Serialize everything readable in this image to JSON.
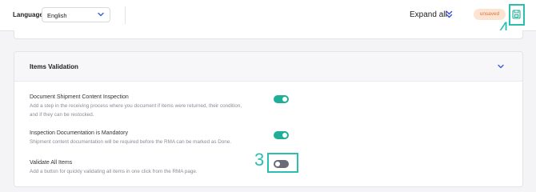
{
  "topbar": {
    "language_label": "Language",
    "language_value": "English",
    "expand_all_label": "Expand all",
    "status_badge": "unsaved",
    "callout_top": "4"
  },
  "section": {
    "title": "Items Validation",
    "settings": [
      {
        "title": "Document Shipment Content Inspection",
        "description_line1": "Add a step in the receiving process where you document if items were returned, their condition,",
        "description_line2": "and if they can be restocked.",
        "enabled": true
      },
      {
        "title": "Inspection Documentation is Mandatory",
        "description_line1": "Shipment content documentation will be required before the RMA can be marked as Done.",
        "enabled": true
      },
      {
        "title": "Validate All Items",
        "description_line1": "Add a button for quickly validating all items in one click from the RMA page.",
        "enabled": false
      }
    ],
    "callout_toggle": "3"
  },
  "colors": {
    "accent": "#1fae97",
    "highlight": "#2abfae",
    "badge_bg": "#fde3d2",
    "badge_text": "#d9773f",
    "toggle_off": "#6b6b78"
  },
  "icons": {
    "language_dropdown": "chevron-down-icon",
    "expand_all": "double-chevron-down-icon",
    "save": "save-icon",
    "section_toggle": "chevron-down-icon"
  }
}
